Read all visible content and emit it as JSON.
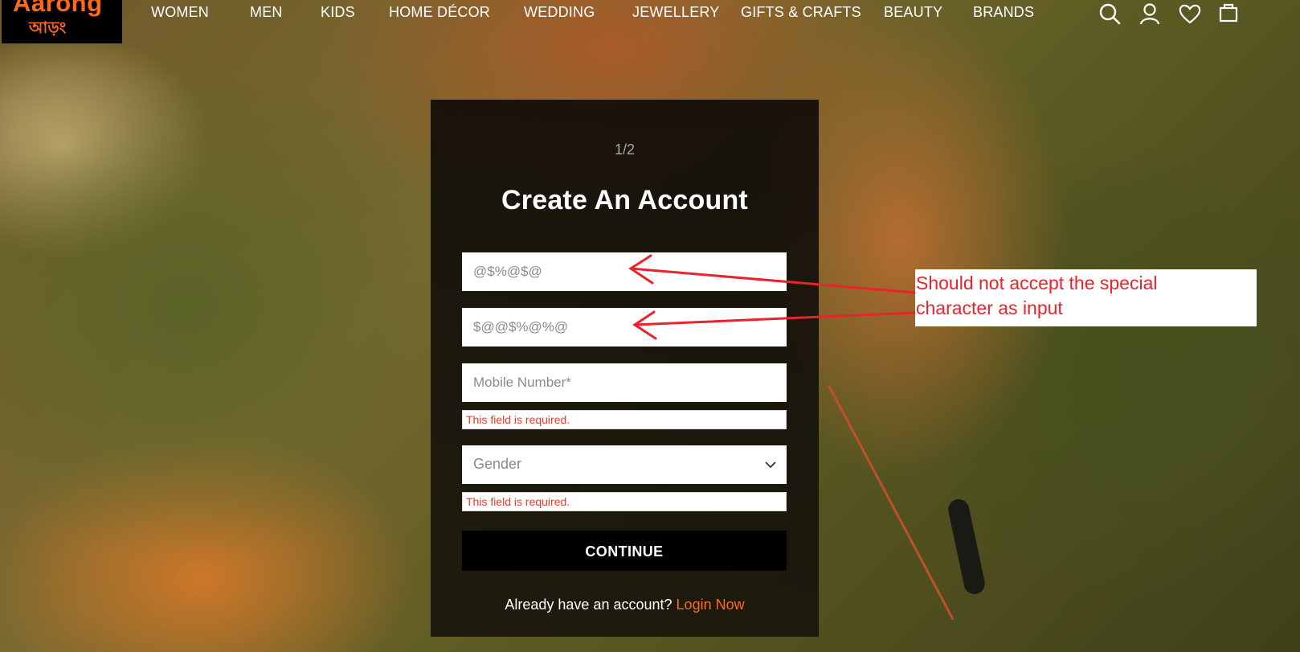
{
  "header": {
    "logo_line1": "Aarong",
    "logo_line2": "আড়ং",
    "nav": [
      {
        "label": "WOMEN"
      },
      {
        "label": "MEN"
      },
      {
        "label": "KIDS"
      },
      {
        "label": "HOME DÉCOR"
      },
      {
        "label": "WEDDING"
      },
      {
        "label": "JEWELLERY"
      },
      {
        "label": "GIFTS & CRAFTS"
      },
      {
        "label": "BEAUTY"
      },
      {
        "label": "BRANDS"
      }
    ],
    "icons": [
      "search-icon",
      "user-icon",
      "heart-icon",
      "bag-icon"
    ]
  },
  "form": {
    "step": "1/2",
    "title": "Create An Account",
    "fields": [
      {
        "value": "@$%@$@",
        "placeholder": ""
      },
      {
        "value": "$@@$%@%@",
        "placeholder": ""
      },
      {
        "value": "",
        "placeholder": "Mobile Number*",
        "error": "This field is required."
      }
    ],
    "gender": {
      "value": "Gender",
      "error": "This field is required."
    },
    "continue_label": "CONTINUE",
    "login_prompt": "Already have an account?",
    "login_link": "Login Now"
  },
  "annotation": {
    "line1": "Should not accept the special",
    "line2": "character as input",
    "color": "#e8232b"
  },
  "colors": {
    "accent": "#ff6a1a",
    "error": "#e53b2b"
  }
}
